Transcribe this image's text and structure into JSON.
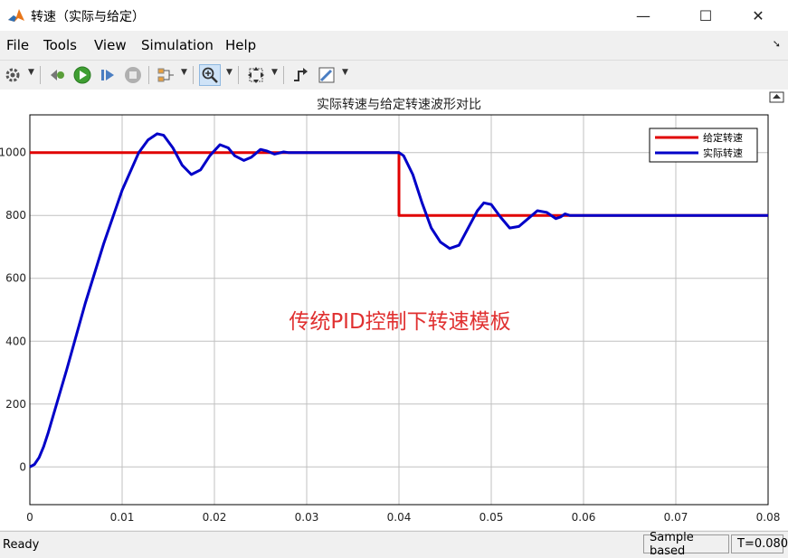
{
  "window": {
    "title": "转速（实际与给定）",
    "minimize_glyph": "—",
    "maximize_glyph": "☐",
    "close_glyph": "✕"
  },
  "menu": {
    "file": "File",
    "tools": "Tools",
    "view": "View",
    "simulation": "Simulation",
    "help": "Help"
  },
  "toolbar": {
    "icons": [
      "gear-icon",
      "restore-icon",
      "run-icon",
      "step-forward-icon",
      "stop-icon",
      "signal-select-icon",
      "zoom-in-icon",
      "fit-to-view-icon",
      "triggers-icon",
      "highlight-icon"
    ]
  },
  "chart_data": {
    "type": "line",
    "title": "实际转速与给定转速波形对比",
    "xlabel": "",
    "ylabel": "",
    "xlim": [
      0,
      0.08
    ],
    "ylim": [
      -120,
      1120
    ],
    "xticks": [
      0,
      0.01,
      0.02,
      0.03,
      0.04,
      0.05,
      0.06,
      0.07,
      0.08
    ],
    "xtick_labels": [
      "0",
      "0.01",
      "0.02",
      "0.03",
      "0.04",
      "0.05",
      "0.06",
      "0.07",
      "0.08"
    ],
    "yticks": [
      0,
      200,
      400,
      600,
      800,
      1000
    ],
    "ytick_labels": [
      "0",
      "200",
      "400",
      "600",
      "800",
      "1000"
    ],
    "grid": true,
    "legend_position": "top-right",
    "annotation": "传统PID控制下转速模板",
    "annotation_color": "#e03030",
    "series": [
      {
        "name": "给定转速",
        "color": "#e00000",
        "x": [
          0,
          0.04,
          0.04,
          0.08
        ],
        "y": [
          1000,
          1000,
          800,
          800
        ]
      },
      {
        "name": "实际转速",
        "color": "#0000c8",
        "x": [
          0,
          0.0005,
          0.001,
          0.0015,
          0.002,
          0.004,
          0.006,
          0.008,
          0.01,
          0.0118,
          0.0128,
          0.0138,
          0.0145,
          0.0155,
          0.0165,
          0.0175,
          0.0185,
          0.0195,
          0.0206,
          0.0215,
          0.0222,
          0.0232,
          0.024,
          0.025,
          0.0257,
          0.0265,
          0.0275,
          0.028,
          0.03,
          0.035,
          0.04,
          0.0405,
          0.0415,
          0.0425,
          0.0435,
          0.0445,
          0.0455,
          0.0465,
          0.0475,
          0.0485,
          0.0492,
          0.05,
          0.051,
          0.052,
          0.053,
          0.054,
          0.055,
          0.056,
          0.057,
          0.0575,
          0.058,
          0.0585,
          0.06,
          0.07,
          0.08
        ],
        "y": [
          0,
          8,
          30,
          65,
          110,
          310,
          520,
          710,
          880,
          1000,
          1040,
          1060,
          1055,
          1015,
          960,
          930,
          945,
          990,
          1025,
          1015,
          990,
          975,
          985,
          1010,
          1005,
          995,
          1002,
          1000,
          1000,
          1000,
          1000,
          990,
          930,
          840,
          760,
          715,
          695,
          705,
          760,
          815,
          840,
          835,
          795,
          760,
          765,
          790,
          815,
          810,
          790,
          795,
          805,
          800,
          800,
          800,
          800
        ]
      }
    ]
  },
  "status": {
    "ready": "Ready",
    "mode": "Sample based",
    "time": "T=0.080"
  }
}
